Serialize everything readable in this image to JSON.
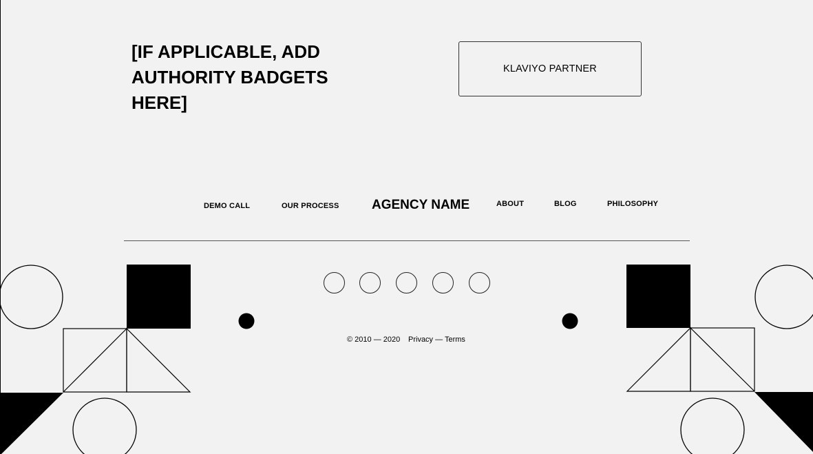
{
  "badges": {
    "heading": "[IF APPLICABLE, ADD AUTHORITY BADGETS HERE]",
    "partner_label": "KLAVIYO PARTNER"
  },
  "nav": {
    "demo_call": "DEMO CALL",
    "our_process": "OUR PROCESS",
    "brand": "AGENCY NAME",
    "about": "ABOUT",
    "blog": "BLOG",
    "philosophy": "PHILOSOPHY"
  },
  "social": {
    "icons": [
      "social-icon-1",
      "social-icon-2",
      "social-icon-3",
      "social-icon-4",
      "social-icon-5"
    ]
  },
  "footer": {
    "copyright": "© 2010 — 2020",
    "privacy": "Privacy",
    "separator": "—",
    "terms": "Terms"
  },
  "colors": {
    "background": "#f2f2f2",
    "ink": "#000000"
  }
}
